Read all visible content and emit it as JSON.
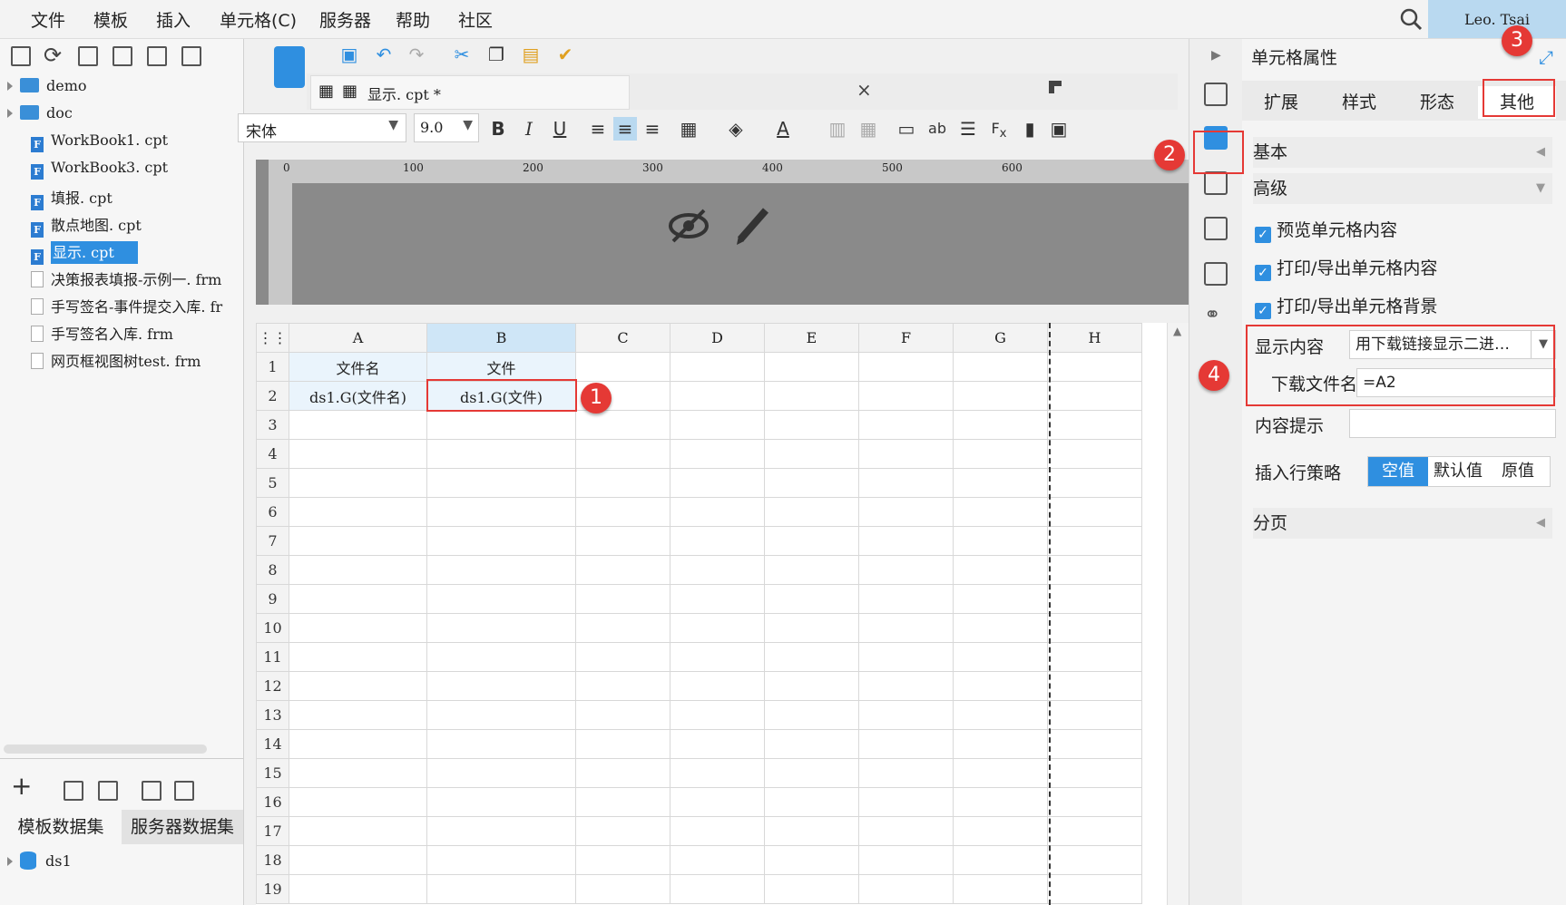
{
  "menu": [
    "文件",
    "模板",
    "插入",
    "单元格(C)",
    "服务器",
    "帮助",
    "社区"
  ],
  "user": "Leo. Tsai",
  "left": {
    "tree": [
      {
        "type": "folder",
        "label": "demo"
      },
      {
        "type": "folder",
        "label": "doc"
      },
      {
        "type": "cpt",
        "label": "WorkBook1. cpt"
      },
      {
        "type": "cpt",
        "label": "WorkBook3. cpt"
      },
      {
        "type": "cpt",
        "label": "填报. cpt"
      },
      {
        "type": "cpt",
        "label": "散点地图. cpt"
      },
      {
        "type": "cpt",
        "label": "显示. cpt",
        "selected": true
      },
      {
        "type": "frm",
        "label": "决策报表填报-示例一. frm"
      },
      {
        "type": "frm",
        "label": "手写签名-事件提交入库. fr"
      },
      {
        "type": "frm",
        "label": "手写签名入库. frm"
      },
      {
        "type": "frm",
        "label": "网页框视图树test. frm"
      }
    ],
    "dataset_tabs": [
      "模板数据集",
      "服务器数据集"
    ],
    "dataset": "ds1"
  },
  "editor": {
    "tab_label": "显示. cpt *",
    "font_name": "宋体",
    "font_size": "9.0",
    "ruler_ticks": [
      "0",
      "100",
      "200",
      "300",
      "400",
      "500",
      "600"
    ],
    "columns": [
      "A",
      "B",
      "C",
      "D",
      "E",
      "F",
      "G",
      "H"
    ],
    "rows": [
      "1",
      "2",
      "3",
      "4",
      "5",
      "6",
      "7",
      "8",
      "9",
      "10",
      "11",
      "12",
      "13",
      "14",
      "15",
      "16",
      "17",
      "18",
      "19"
    ],
    "cells": {
      "A1": "文件名",
      "B1": "文件",
      "A2": "ds1.G(文件名)",
      "B2": "ds1.G(文件)"
    }
  },
  "props": {
    "title": "单元格属性",
    "tabs": [
      "扩展",
      "样式",
      "形态",
      "其他"
    ],
    "section_basic": "基本",
    "section_advanced": "高级",
    "checks": [
      "预览单元格内容",
      "打印/导出单元格内容",
      "打印/导出单元格背景"
    ],
    "display_label": "显示内容",
    "display_value": "用下载链接显示二进…",
    "download_label": "下载文件名",
    "download_value": "=A2",
    "tip_label": "内容提示",
    "tip_value": "",
    "insert_label": "插入行策略",
    "insert_options": [
      "空值",
      "默认值",
      "原值"
    ],
    "section_page": "分页"
  },
  "markers": [
    "1",
    "2",
    "3",
    "4"
  ],
  "colors": {
    "accent": "#2f8fe0",
    "highlight": "#e53935",
    "selected": "#2f8fe0"
  }
}
